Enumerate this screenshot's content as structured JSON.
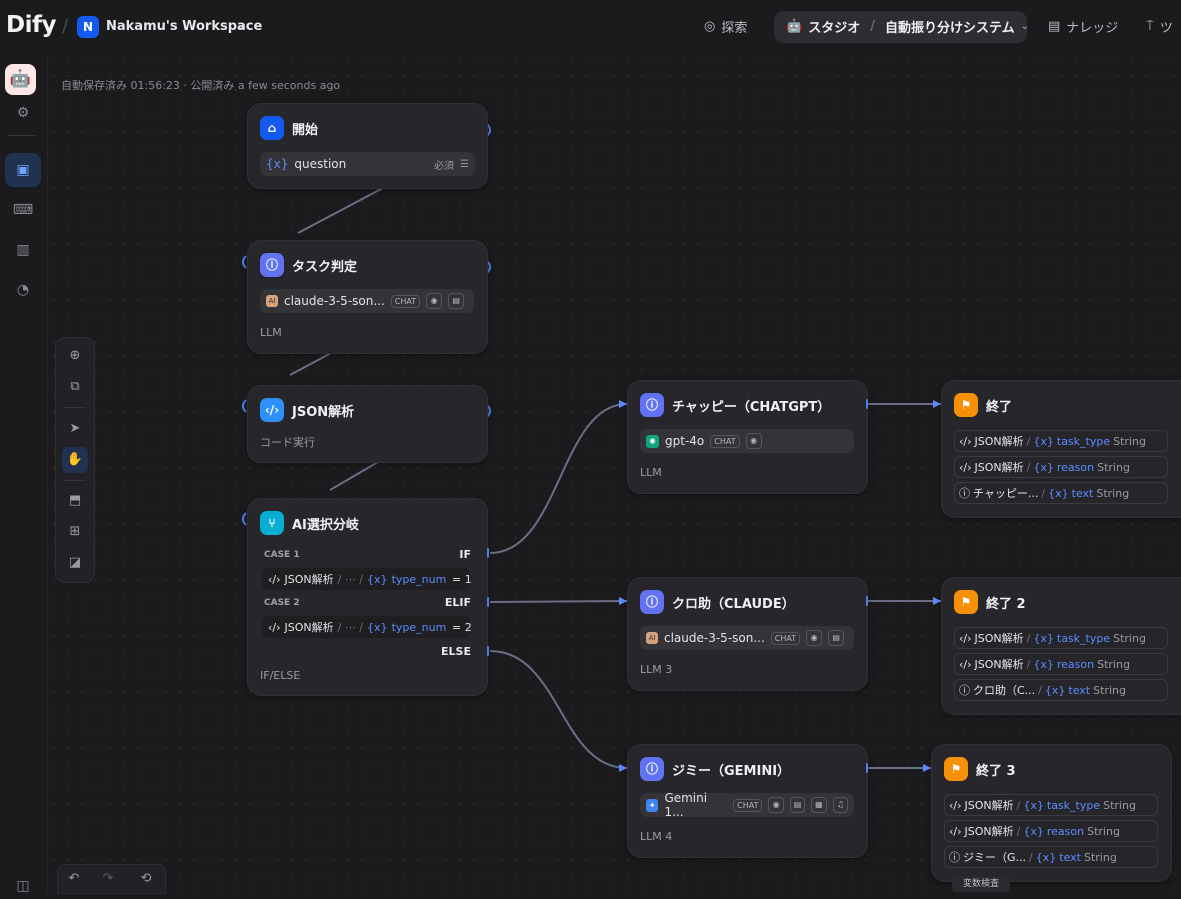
{
  "header": {
    "logo": "Dify",
    "workspace_initial": "N",
    "workspace_name": "Nakamu's Workspace",
    "nav_explore": "探索",
    "nav_studio": "スタジオ",
    "app_name": "自動振り分けシステム",
    "nav_knowledge": "ナレッジ",
    "nav_tools": "ツ"
  },
  "status": {
    "autosave": "自動保存済み 01:56:23 · 公開済み a few seconds ago"
  },
  "nodes": {
    "start": {
      "title": "開始",
      "var": "question",
      "required": "必須"
    },
    "task": {
      "title": "タスク判定",
      "model": "claude-3-5-son...",
      "tag": "CHAT",
      "sub": "LLM"
    },
    "json": {
      "title": "JSON解析",
      "sub": "コード実行"
    },
    "ifelse": {
      "title": "AI選択分岐",
      "case1": "CASE 1",
      "case2": "CASE 2",
      "if": "IF",
      "elif": "ELIF",
      "else": "ELSE",
      "cond_node": "JSON解析",
      "cond_sep": "/ ⋯ /",
      "cond_var": "type_num",
      "val1": "= 1",
      "val2": "= 2",
      "sub": "IF/ELSE"
    },
    "chatgpt": {
      "title": "チャッピー（CHATGPT）",
      "model": "gpt-4o",
      "tag": "CHAT",
      "sub": "LLM"
    },
    "claude": {
      "title": "クロ助（CLAUDE）",
      "model": "claude-3-5-son...",
      "tag": "CHAT",
      "sub": "LLM 3"
    },
    "gemini": {
      "title": "ジミー（GEMINI）",
      "model": "Gemini 1...",
      "tag": "CHAT",
      "sub": "LLM 4"
    },
    "end1": {
      "title": "終了",
      "rows": [
        {
          "node": "JSON解析",
          "var": "task_type",
          "type": "String"
        },
        {
          "node": "JSON解析",
          "var": "reason",
          "type": "String"
        },
        {
          "node": "チャッピー...",
          "var": "text",
          "type": "String"
        }
      ]
    },
    "end2": {
      "title": "終了 2",
      "rows": [
        {
          "node": "JSON解析",
          "var": "task_type",
          "type": "String"
        },
        {
          "node": "JSON解析",
          "var": "reason",
          "type": "String"
        },
        {
          "node": "クロ助（C...",
          "var": "text",
          "type": "String"
        }
      ]
    },
    "end3": {
      "title": "終了 3",
      "rows": [
        {
          "node": "JSON解析",
          "var": "task_type",
          "type": "String"
        },
        {
          "node": "JSON解析",
          "var": "reason",
          "type": "String"
        },
        {
          "node": "ジミー（G...",
          "var": "text",
          "type": "String"
        }
      ]
    }
  },
  "hint": "変数検査",
  "colors": {
    "accent": "#155aef",
    "handle": "#4f7de8",
    "llm": "#6172f3",
    "code": "#2e90fa",
    "ifelse": "#06aed4",
    "end": "#f79009"
  }
}
